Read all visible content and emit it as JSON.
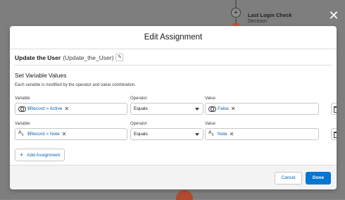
{
  "canvas": {
    "node_title": "Last Login Check",
    "node_type": "Decision"
  },
  "modal": {
    "title": "Edit Assignment",
    "element_label": "Update the User",
    "element_api_name": "(Update_the_User)",
    "section_title": "Set Variable Values",
    "section_description": "Each variable is modified by the operator and value combination.",
    "column_labels": {
      "variable": "Variable",
      "operator": "Operator",
      "value": "Value"
    },
    "assignments": [
      {
        "variable_icon": "toggle-boolean-icon",
        "variable": "$Record > Active",
        "operator": "Equals",
        "value_icon": "toggle-boolean-icon",
        "value": "False"
      },
      {
        "variable_icon": "text-type-icon",
        "variable": "$Record > Note",
        "operator": "Equals",
        "value_icon": "text-type-icon",
        "value": "Note"
      }
    ],
    "add_assignment_label": "Add Assignment",
    "cancel_label": "Cancel",
    "done_label": "Done"
  },
  "colors": {
    "brand_blue": "#0176d3",
    "link_blue": "#0b5cab",
    "node_orange": "#b9573a"
  }
}
